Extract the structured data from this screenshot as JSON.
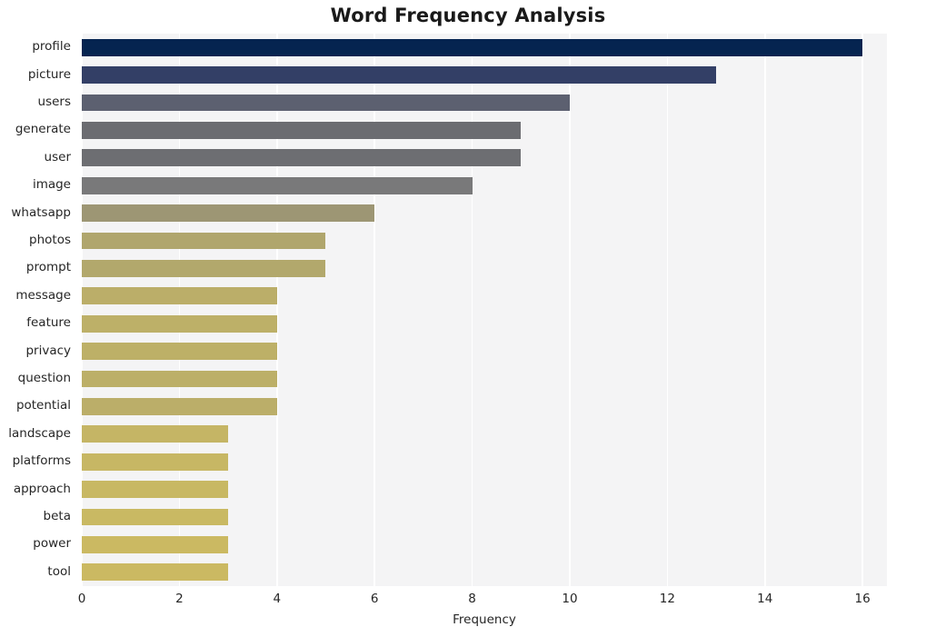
{
  "chart_data": {
    "type": "bar",
    "orientation": "horizontal",
    "title": "Word Frequency Analysis",
    "xlabel": "Frequency",
    "ylabel": "",
    "xlim": [
      0,
      16.5
    ],
    "xticks": [
      0,
      2,
      4,
      6,
      8,
      10,
      12,
      14,
      16
    ],
    "grid": "vertical",
    "legend": "none",
    "categories": [
      "profile",
      "picture",
      "users",
      "generate",
      "user",
      "image",
      "whatsapp",
      "photos",
      "prompt",
      "message",
      "feature",
      "privacy",
      "question",
      "potential",
      "landscape",
      "platforms",
      "approach",
      "beta",
      "power",
      "tool"
    ],
    "values": [
      16,
      13,
      10,
      9,
      9,
      8,
      6,
      5,
      5,
      4,
      4,
      4,
      4,
      4,
      3,
      3,
      3,
      3,
      3,
      3
    ],
    "bar_colors": [
      "#052450",
      "#333f66",
      "#5c6070",
      "#6b6c71",
      "#6d6e72",
      "#79797a",
      "#9d9674",
      "#b0a66d",
      "#b2a86c",
      "#bbae69",
      "#bdb068",
      "#bdb067",
      "#bcaf68",
      "#bbae69",
      "#c5b565",
      "#c7b764",
      "#c8b863",
      "#c9b963",
      "#cbb962",
      "#cbb962"
    ],
    "plot_background": "#f4f4f5",
    "gridline_color": "#ffffff",
    "figure_background": "#ffffff",
    "text_color": "#262626"
  }
}
